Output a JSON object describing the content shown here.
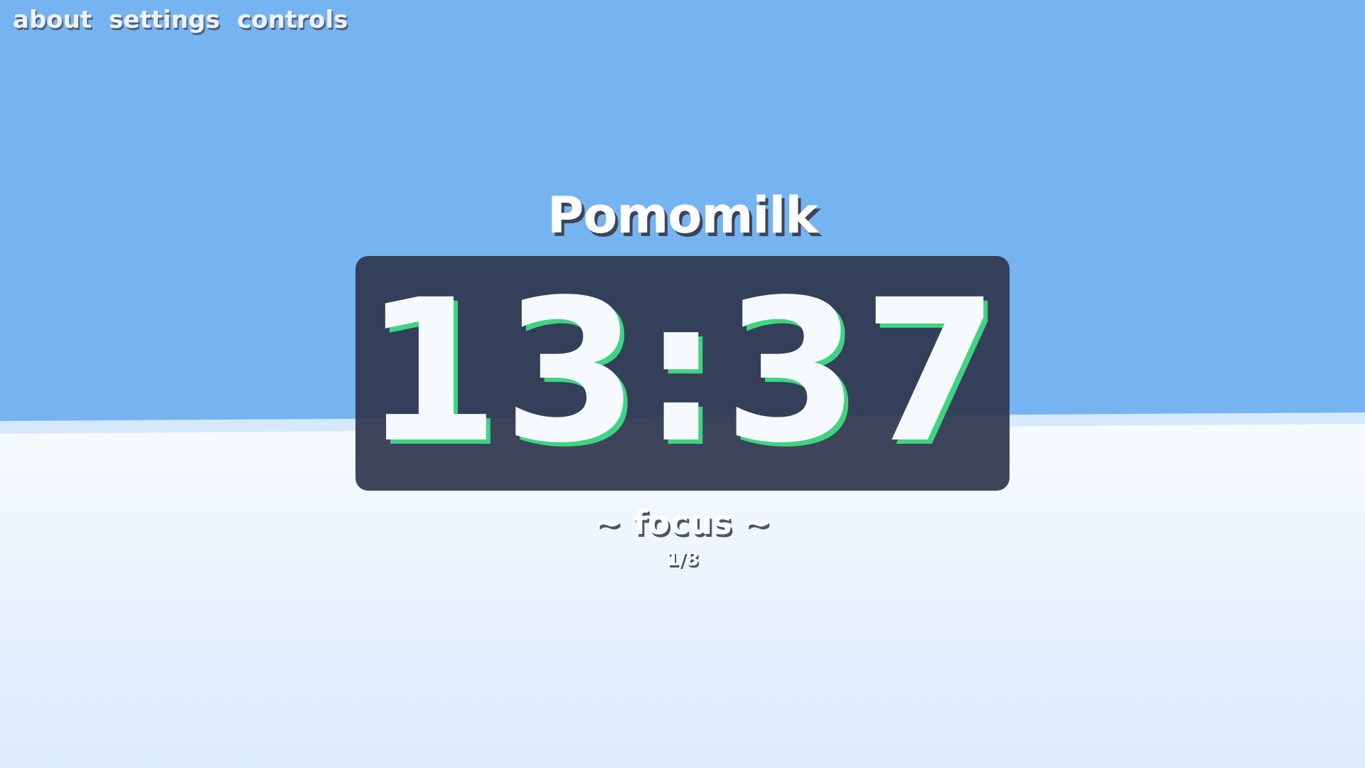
{
  "nav": {
    "about_label": "about",
    "settings_label": "settings",
    "controls_label": "controls"
  },
  "app": {
    "title": "Pomomilk"
  },
  "timer": {
    "display": "13:37",
    "mode_label": "~ focus ~",
    "session_counter": "1/8"
  },
  "colors": {
    "sky": "#75b4f0",
    "ground_top": "#f7fbff",
    "ground_bottom": "#dbeafc",
    "timer_panel": "#2f374e",
    "timer_accent": "#3fd482"
  }
}
